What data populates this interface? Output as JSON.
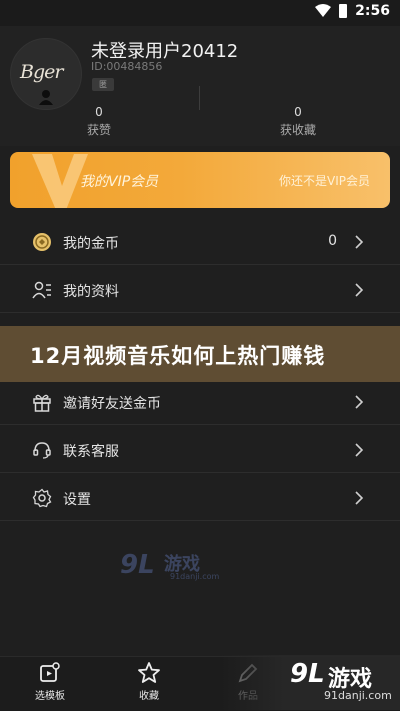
{
  "status_bar": {
    "time": "2:56"
  },
  "profile": {
    "avatar_logo": "Bger",
    "username": "未登录用户20412",
    "user_id": "ID:00484856",
    "badge": "匿",
    "stats": [
      {
        "value": "0",
        "label": "获赞"
      },
      {
        "value": "0",
        "label": "获收藏"
      }
    ]
  },
  "vip": {
    "title": "我的VIP会员",
    "status": "你还不是VIP会员"
  },
  "menu": [
    {
      "label": "我的金币",
      "value": "0",
      "icon": "coin-icon"
    },
    {
      "label": "我的资料",
      "value": "",
      "icon": "profile-card-icon"
    },
    {
      "label": "邀请好友送金币",
      "value": "",
      "icon": "gift-icon"
    },
    {
      "label": "联系客服",
      "value": "",
      "icon": "headset-icon"
    },
    {
      "label": "设置",
      "value": "",
      "icon": "gear-icon"
    }
  ],
  "overlay_title": "12月视频音乐如何上热门赚钱",
  "watermark_mid": {
    "logo": "9L",
    "text": "游戏",
    "url": "91danji.com"
  },
  "bottom_nav": [
    {
      "label": "选模板",
      "icon": "template-icon"
    },
    {
      "label": "收藏",
      "icon": "star-icon"
    },
    {
      "label": "作品",
      "icon": "edit-icon"
    }
  ],
  "watermark_corner": {
    "logo": "9L",
    "text": "游戏",
    "url": "91danji.com"
  },
  "colors": {
    "vip_gold": "#f1a12c",
    "background": "#1f1f1f"
  }
}
